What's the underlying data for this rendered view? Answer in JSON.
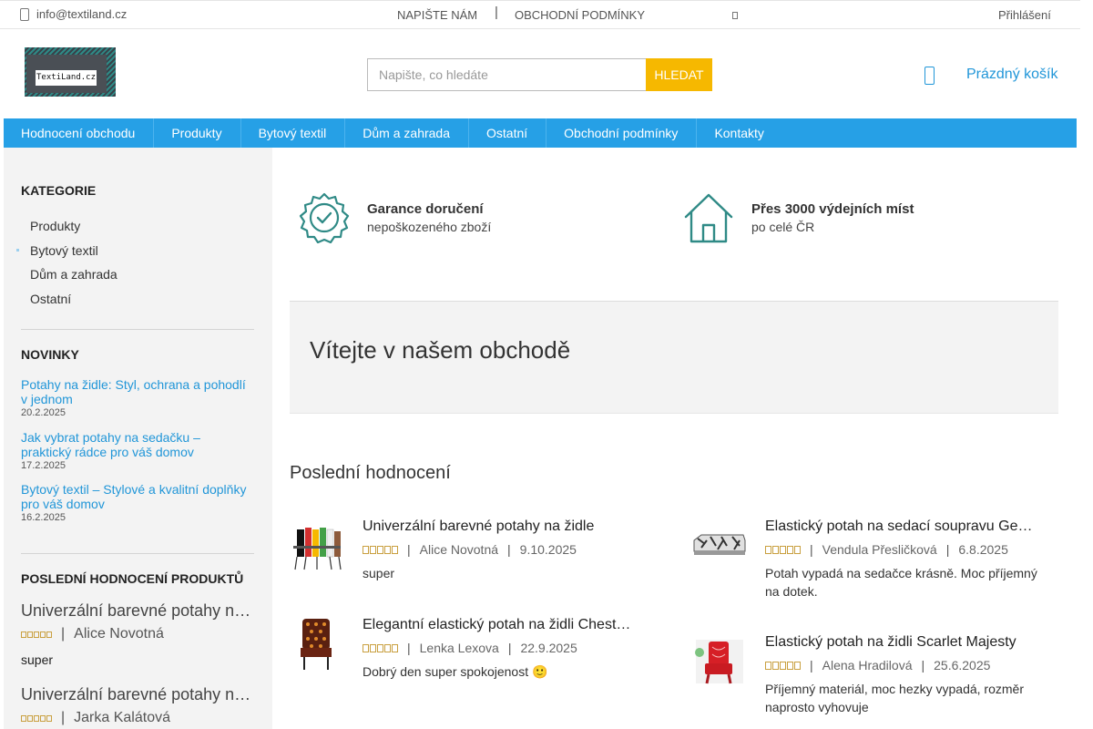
{
  "topbar": {
    "email": "info@textiland.cz",
    "write_us": "NAPIŠTE NÁM",
    "terms": "OBCHODNÍ PODMÍNKY",
    "login": "Přihlášení"
  },
  "header": {
    "logo_text": "TextiLand.cz",
    "search_placeholder": "Napište, co hledáte",
    "search_button": "HLEDAT",
    "cart_label": "Prázdný košík"
  },
  "nav": {
    "items": [
      {
        "label": "Hodnocení obchodu"
      },
      {
        "label": "Produkty"
      },
      {
        "label": "Bytový textil"
      },
      {
        "label": "Dům a zahrada"
      },
      {
        "label": "Ostatní"
      },
      {
        "label": "Obchodní podmínky"
      },
      {
        "label": "Kontakty"
      }
    ]
  },
  "sidebar": {
    "categories_title": "KATEGORIE",
    "categories": [
      "Produkty",
      "Bytový textil",
      "Dům a zahrada",
      "Ostatní"
    ],
    "news_title": "NOVINKY",
    "news": [
      {
        "title": "Potahy na židle: Styl, ochrana a pohodlí v jednom",
        "date": "20.2.2025"
      },
      {
        "title": "Jak vybrat potahy na sedačku – praktický rádce pro váš domov",
        "date": "17.2.2025"
      },
      {
        "title": "Bytový textil – Stylové a kvalitní doplňky pro váš domov",
        "date": "16.2.2025"
      }
    ],
    "reviews_title": "POSLEDNÍ HODNOCENÍ PRODUKTŮ",
    "reviews": [
      {
        "product": "Univerzální barevné potahy na židle",
        "author": "Alice Novotná",
        "text": "super"
      },
      {
        "product": "Univerzální barevné potahy na židle",
        "author": "Jarka Kalátová",
        "text": ""
      }
    ]
  },
  "features": [
    {
      "title": "Garance doručení",
      "subtitle": "nepoškozeného zboží",
      "icon": "badge-check-icon"
    },
    {
      "title": "Přes 3000 výdejních míst",
      "subtitle": "po celé ČR",
      "icon": "house-icon"
    }
  ],
  "welcome": {
    "heading": "Vítejte v našem obchodě"
  },
  "latest_reviews": {
    "title": "Poslední hodnocení",
    "items": [
      {
        "product": "Univerzální barevné potahy na židle",
        "author": "Alice Novotná",
        "date": "9.10.2025",
        "text": "super"
      },
      {
        "product": "Elastický potah na sedací soupravu Geometric Charm",
        "author": "Vendula Přesličková",
        "date": "6.8.2025",
        "text": "Potah vypadá na sedačce krásně. Moc příjemný na dotek."
      },
      {
        "product": "Elegantní elastický potah na židli Chesterfield",
        "author": "Lenka Lexova",
        "date": "22.9.2025",
        "text": "Dobrý den super spokojenost 🙂"
      },
      {
        "product": "Elastický potah na židli Scarlet Majesty",
        "author": "Alena Hradilová",
        "date": "25.6.2025",
        "text": "Příjemný materiál, moc hezky vypadá, rozměr naprosto vyhovuje"
      }
    ]
  },
  "colors": {
    "accent": "#26a0e6",
    "search_button": "#f6b800",
    "icon_teal": "#2f8a86",
    "stars": "#c9a040"
  }
}
